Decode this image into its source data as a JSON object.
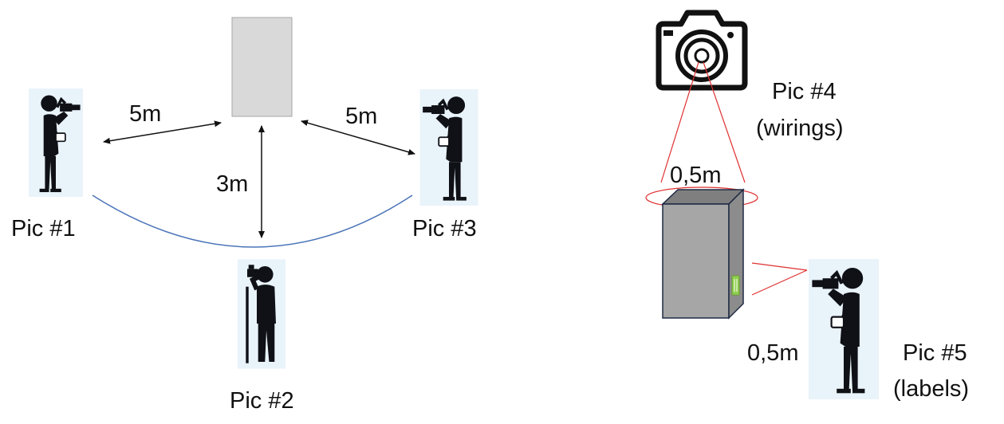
{
  "left_setup": {
    "positions": [
      {
        "label": "Pic #1"
      },
      {
        "label": "Pic #2"
      },
      {
        "label": "Pic #3"
      }
    ],
    "distances": {
      "left": "5m",
      "right": "5m",
      "center": "3m"
    }
  },
  "right_setup": {
    "top_shot": {
      "label": "Pic #4",
      "note": "(wirings)",
      "distance": "0,5m"
    },
    "side_shot": {
      "label": "Pic #5",
      "note": "(labels)",
      "distance": "0,5m"
    }
  },
  "colors": {
    "object_fill": "#d9d9d9",
    "cabinet_front": "#a6a6a6",
    "cabinet_side": "#8c8c8c",
    "cabinet_top": "#7f7f7f",
    "label_tag": "#92d050",
    "arc": "#4a74b8",
    "view_lines": "#e03030",
    "figure_backdrop": "#e9f3fa"
  },
  "icons": {
    "photographer": "photographer-icon",
    "camera": "camera-icon"
  }
}
